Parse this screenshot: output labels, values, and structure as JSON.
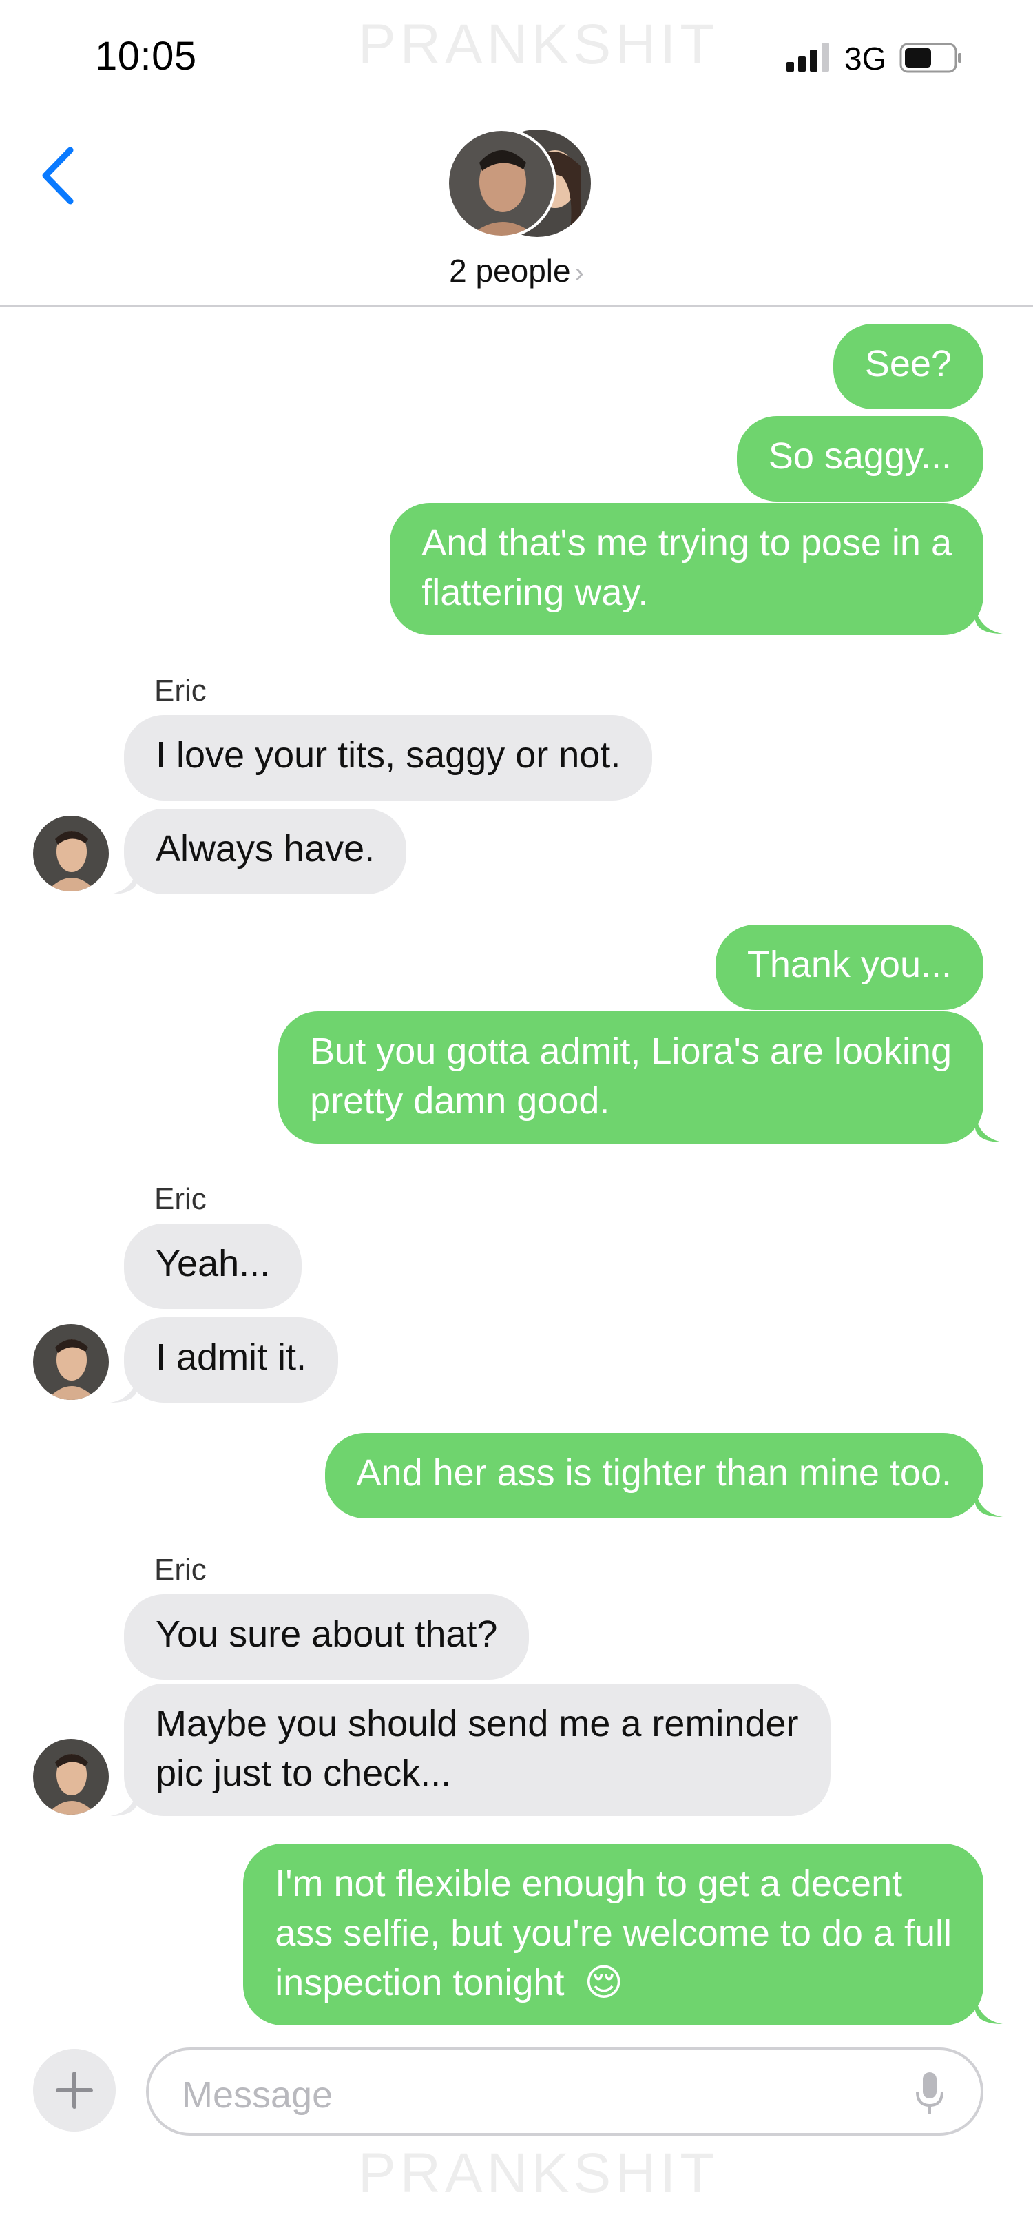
{
  "status_bar": {
    "time": "10:05",
    "network": "3G"
  },
  "watermark": "PRANKSHIT",
  "header": {
    "group_label": "2 people",
    "chevron": "›",
    "icons": [
      "back-chevron-icon",
      "group-avatar-icon"
    ]
  },
  "messages": [
    {
      "from": "me",
      "text": "See?"
    },
    {
      "from": "me",
      "text": "So saggy..."
    },
    {
      "from": "me",
      "lines": [
        "And that's me trying to pose in a",
        "flattering way."
      ]
    },
    {
      "from": "Eric",
      "sender_label": "Eric",
      "text": "I love your tits, saggy or not."
    },
    {
      "from": "Eric",
      "text": "Always have."
    },
    {
      "from": "me",
      "text": "Thank you..."
    },
    {
      "from": "me",
      "lines": [
        "But you gotta admit, Liora's are looking",
        "pretty damn good."
      ]
    },
    {
      "from": "Eric",
      "sender_label": "Eric",
      "text": "Yeah..."
    },
    {
      "from": "Eric",
      "text": "I admit it."
    },
    {
      "from": "me",
      "text": "And her ass is tighter than mine too."
    },
    {
      "from": "Eric",
      "sender_label": "Eric",
      "text": "You sure about that?"
    },
    {
      "from": "Eric",
      "lines": [
        "Maybe you should send me a reminder",
        "pic just to check..."
      ]
    },
    {
      "from": "me",
      "lines": [
        "I'm not flexible enough to get a decent",
        "ass selfie, but you're welcome to do a full",
        "inspection tonight"
      ],
      "emoji": "😌"
    }
  ],
  "composer": {
    "placeholder": "Message",
    "plus_label": "+"
  },
  "colors": {
    "outgoing_bubble": "#6fd46e",
    "incoming_bubble": "#e9e9eb",
    "accent": "#0a7aff"
  }
}
